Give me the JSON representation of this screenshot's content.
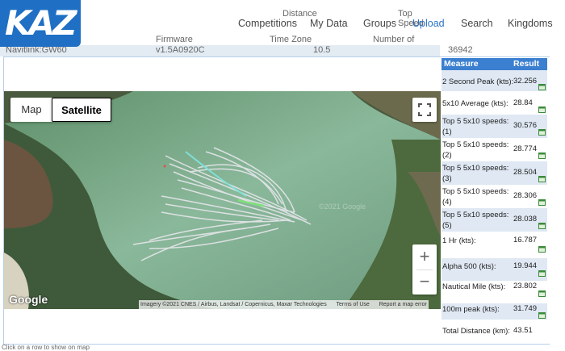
{
  "background_table": {
    "headers_row1": [
      "Distance",
      "Top Speed"
    ],
    "headers_row2": [
      "Firmware",
      "Time Zone",
      "Number of Points"
    ],
    "row": [
      "Navitlink:GW60",
      "v1.5A0920C",
      "10.5",
      "36942"
    ]
  },
  "header": {
    "logo": "KAZ",
    "nav": [
      {
        "label": "Competitions",
        "active": false
      },
      {
        "label": "My Data",
        "active": false
      },
      {
        "label": "Groups",
        "active": false
      },
      {
        "label": "Upload",
        "active": true
      },
      {
        "label": "Search",
        "active": false
      },
      {
        "label": "Kingdoms",
        "active": false
      }
    ]
  },
  "map": {
    "type_options": [
      "Map",
      "Satellite"
    ],
    "selected_type": "Satellite",
    "watermark": "©2021 Google",
    "google_logo": "Google",
    "attribution": {
      "imagery": "Imagery ©2021 CNES / Airbus, Landsat / Copernicus, Maxar Technologies",
      "terms": "Terms of Use",
      "report": "Report a map error"
    },
    "zoom_in": "+",
    "zoom_out": "−",
    "colors": {
      "track": "#e8e8ec",
      "track_fast": "#7fe0d8",
      "track_peak": "#7fe07a"
    }
  },
  "results": {
    "header_measure": "Measure",
    "header_result": "Result",
    "rows": [
      {
        "label": "2 Second Peak (kts):",
        "value": "32.256"
      },
      {
        "label": "5x10 Average (kts):",
        "value": "28.84"
      },
      {
        "label": "Top 5 5x10 speeds: (1)",
        "value": "30.576"
      },
      {
        "label": "Top 5 5x10 speeds: (2)",
        "value": "28.774"
      },
      {
        "label": "Top 5 5x10 speeds: (3)",
        "value": "28.504"
      },
      {
        "label": "Top 5 5x10 speeds: (4)",
        "value": "28.306"
      },
      {
        "label": "Top 5 5x10 speeds: (5)",
        "value": "28.038"
      },
      {
        "label": "1 Hr (kts):",
        "value": "16.787"
      },
      {
        "label": "Alpha 500 (kts):",
        "value": "19.944"
      },
      {
        "label": "Nautical Mile (kts):",
        "value": "23.802"
      },
      {
        "label": "100m peak (kts):",
        "value": "31.749"
      },
      {
        "label": "Total Distance (km):",
        "value": "43.51"
      }
    ]
  },
  "footer_hint": "Click on a row to show on map"
}
